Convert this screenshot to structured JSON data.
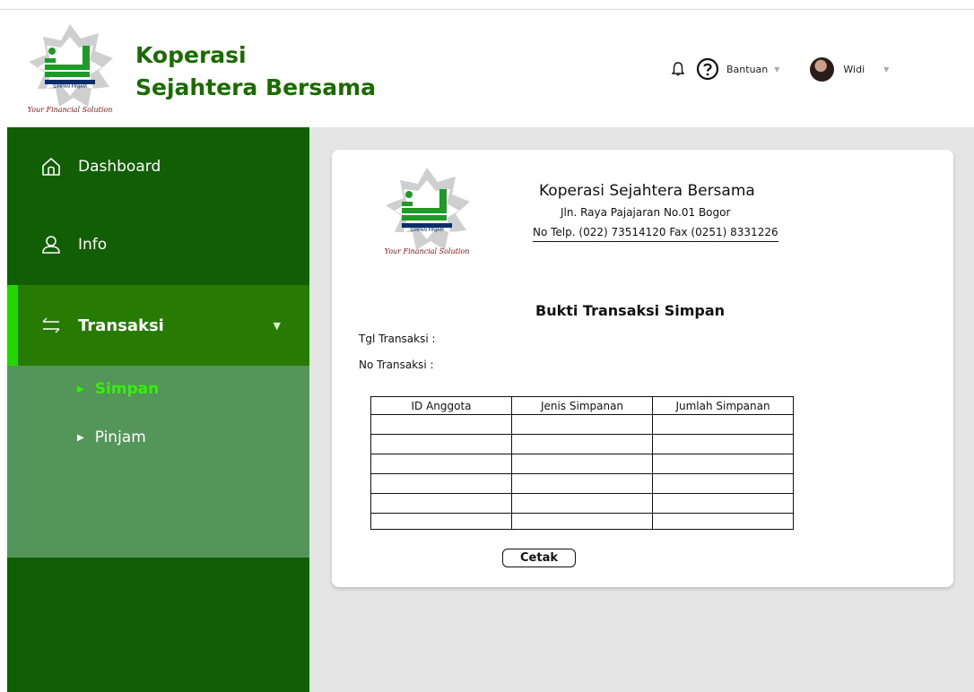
{
  "brand": {
    "title_line1": "Koperasi",
    "title_line2": "Sejahtera Bersama",
    "logo_caption": "Your Financial Solution",
    "logo_subtext": "SIMPAN PINJAM"
  },
  "header": {
    "help_label": "Bantuan",
    "user_name": "Widi"
  },
  "sidebar": {
    "items": [
      {
        "label": "Dashboard",
        "icon": "home-icon"
      },
      {
        "label": "Info",
        "icon": "user-icon"
      },
      {
        "label": "Transaksi",
        "icon": "transfer-arrows-icon"
      }
    ],
    "submenu": [
      {
        "label": "Simpan",
        "active": true
      },
      {
        "label": "Pinjam",
        "active": false
      }
    ]
  },
  "receipt": {
    "org_name": "Koperasi Sejahtera Bersama",
    "org_address": "Jln. Raya Pajajaran No.01 Bogor",
    "org_phone": "No Telp. (022) 73514120  Fax (0251) 8331226",
    "title": "Bukti Transaksi Simpan",
    "tgl_label": "Tgl Transaksi :",
    "no_label": "No Transaksi :",
    "table": {
      "headers": [
        "ID Anggota",
        "Jenis Simpanan",
        "Jumlah Simpanan"
      ],
      "rows": [
        [
          "",
          "",
          ""
        ],
        [
          "",
          "",
          ""
        ],
        [
          "",
          "",
          ""
        ],
        [
          "",
          "",
          ""
        ],
        [
          "",
          "",
          ""
        ],
        [
          "",
          "",
          ""
        ]
      ]
    },
    "print_label": "Cetak"
  },
  "colors": {
    "sidebar_bg": "#115e04",
    "active_bg": "#277a02",
    "submenu_bg": "#54965a",
    "accent": "#25d600",
    "brand_green": "#1a6b00"
  }
}
